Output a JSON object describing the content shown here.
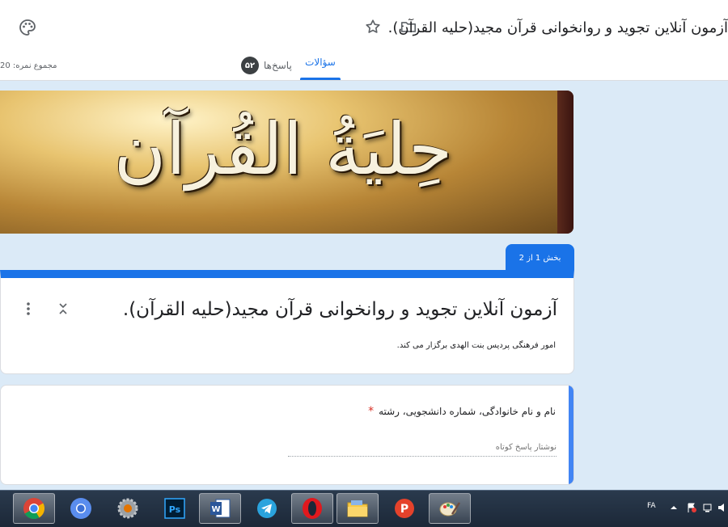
{
  "header": {
    "title": "آزمون آنلاین تجوید و روانخوانی قرآن مجید(حلیه القرآن).",
    "icons": [
      "palette-icon",
      "folder-icon",
      "star-icon"
    ]
  },
  "tabs": {
    "questions_label": "سؤالات",
    "responses_label": "پاسخ‌ها",
    "responses_count": "۵۲",
    "total_points": "مجموع نمره: 20"
  },
  "banner": {
    "text": "حِلیَةُ القُرآن"
  },
  "section": {
    "label": "بخش 1 از 2"
  },
  "form": {
    "title": "آزمون آنلاین تجوید و روانخوانی قرآن مجید(حلیه القرآن).",
    "description": "امور فرهنگی پردیس بنت الهدی برگزار می کند."
  },
  "question": {
    "title": "نام و نام خانوادگی، شماره دانشجویی، رشته",
    "required_mark": "*",
    "placeholder": "نوشتار پاسخ کوتاه"
  },
  "taskbar": {
    "apps": [
      "chrome-icon",
      "chromium-icon",
      "settings-icon",
      "photoshop-icon",
      "word-icon",
      "telegram-icon",
      "opera-icon",
      "file-explorer-icon",
      "psiphon-icon",
      "paint-icon"
    ],
    "lang": "FA"
  },
  "colors": {
    "accent": "#1a73e8",
    "background": "#dbeaf7",
    "taskbar": "#1c2838"
  }
}
